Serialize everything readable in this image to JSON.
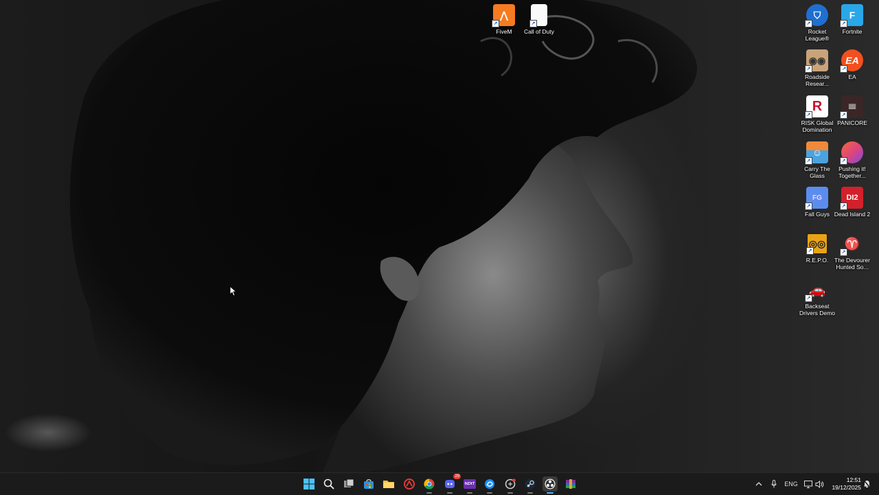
{
  "desktop_icons": [
    {
      "label": "FiveM",
      "icon": "fivem-icon",
      "color": "#f47b20"
    },
    {
      "label": "Call of Duty",
      "icon": "blank-file-icon",
      "color": "#ffffff"
    },
    {
      "label": "Rocket League®",
      "icon": "rocket-league-icon",
      "color": "#1f6fd1"
    },
    {
      "label": "Fortnite",
      "icon": "fortnite-icon",
      "color": "#2aa7e8"
    },
    {
      "label": "Roadside Resear...",
      "icon": "roadside-research-icon",
      "color": "#c9a37a"
    },
    {
      "label": "EA",
      "icon": "ea-icon",
      "color": "#f2501e"
    },
    {
      "label": "RISK Global Domination",
      "icon": "risk-icon",
      "color": "#c8102e"
    },
    {
      "label": "PANICORE",
      "icon": "panicore-icon",
      "color": "#3a2626"
    },
    {
      "label": "Carry The Glass",
      "icon": "carry-the-glass-icon",
      "color": "#4aa3df"
    },
    {
      "label": "Pushing it! Together...",
      "icon": "pushing-it-icon",
      "color": "#e0457b"
    },
    {
      "label": "Fall Guys",
      "icon": "fall-guys-icon",
      "color": "#5b8def"
    },
    {
      "label": "Dead Island 2",
      "icon": "dead-island-2-icon",
      "color": "#d4202a"
    },
    {
      "label": "R.E.P.O.",
      "icon": "repo-icon",
      "color": "#2a2a1a"
    },
    {
      "label": "The Devourer Hunted So...",
      "icon": "devourer-icon",
      "color": "#2b2b2b"
    },
    {
      "label": "Backseat Drivers Demo",
      "icon": "backseat-drivers-icon",
      "color": "#c62828"
    }
  ],
  "taskbar": {
    "apps": [
      {
        "name": "start-button",
        "icon": "windows-icon"
      },
      {
        "name": "search-button",
        "icon": "search-icon"
      },
      {
        "name": "task-view-button",
        "icon": "task-view-icon"
      },
      {
        "name": "store-app",
        "icon": "store-icon"
      },
      {
        "name": "file-explorer-app",
        "icon": "folder-icon"
      },
      {
        "name": "app-red-circle",
        "icon": "red-circle-icon"
      },
      {
        "name": "chrome-app",
        "icon": "chrome-icon"
      },
      {
        "name": "discord-app",
        "icon": "discord-icon",
        "badge": "29"
      },
      {
        "name": "nzxt-app",
        "icon": "nzxt-icon",
        "text": "NZXT"
      },
      {
        "name": "battlenet-app",
        "icon": "battlenet-icon"
      },
      {
        "name": "app-circle-red-dot",
        "icon": "circle-icon"
      },
      {
        "name": "steam-app",
        "icon": "steam-icon"
      },
      {
        "name": "obs-app",
        "icon": "obs-icon"
      },
      {
        "name": "winrar-app",
        "icon": "winrar-icon"
      }
    ],
    "tray": {
      "language": "ENG",
      "time": "12:51",
      "date": "19/12/2025"
    }
  }
}
